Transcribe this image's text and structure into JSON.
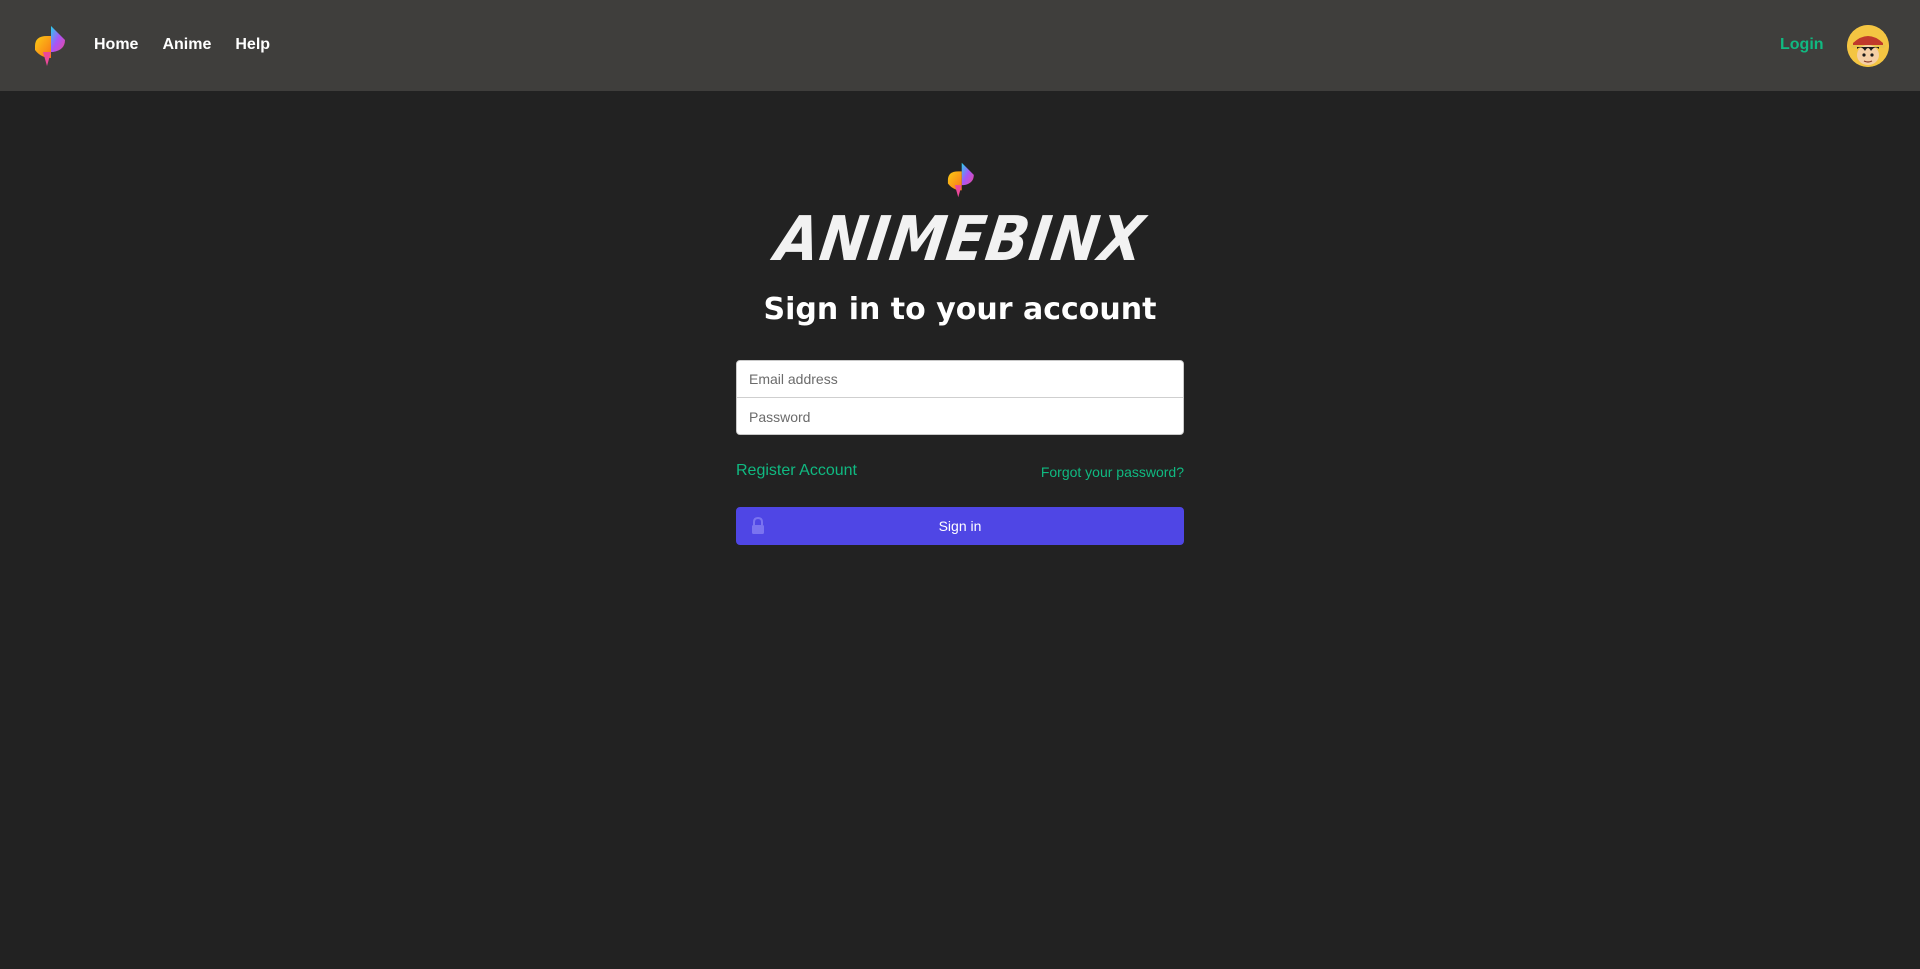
{
  "nav": {
    "logo_icon": "app-logo-icon",
    "links": [
      "Home",
      "Anime",
      "Help"
    ],
    "login_label": "Login",
    "avatar_icon": "user-avatar-icon"
  },
  "brand": {
    "wordmark": "ANIMEBINX",
    "logo_icon": "app-logo-icon"
  },
  "signin": {
    "heading": "Sign in to your account",
    "email_placeholder": "Email address",
    "password_placeholder": "Password",
    "register_label": "Register Account",
    "forgot_label": "Forgot your password?",
    "submit_label": "Sign in",
    "submit_icon": "lock-icon"
  },
  "colors": {
    "page_bg": "#222222",
    "topbar_bg": "#3f3e3c",
    "accent_green": "#10b981",
    "button_indigo": "#4f46e5"
  }
}
